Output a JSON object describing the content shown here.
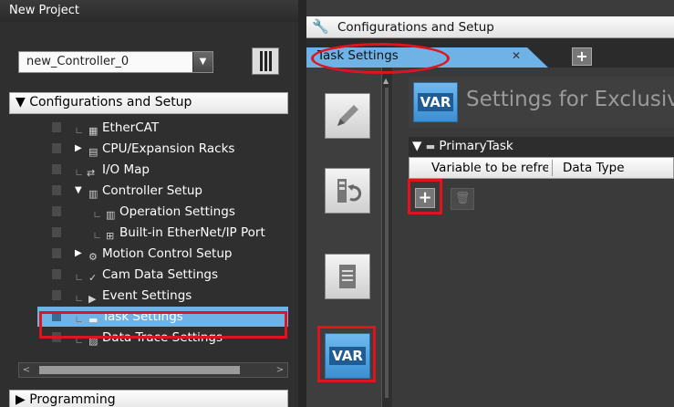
{
  "project": {
    "title": "New Project"
  },
  "controller": {
    "selected": "new_Controller_0"
  },
  "sections": {
    "config": "Configurations and Setup",
    "programming": "Programming"
  },
  "tree": [
    {
      "label": "EtherCAT",
      "icon": "ethercat-icon",
      "arrow": ""
    },
    {
      "label": "CPU/Expansion Racks",
      "icon": "cpu-rack-icon",
      "arrow": "▶"
    },
    {
      "label": "I/O Map",
      "icon": "io-map-icon",
      "arrow": ""
    },
    {
      "label": "Controller Setup",
      "icon": "controller-setup-icon",
      "arrow": "▼"
    },
    {
      "label": "Operation Settings",
      "icon": "operation-settings-icon",
      "arrow": ""
    },
    {
      "label": "Built-in EtherNet/IP Port",
      "icon": "ethernet-port-icon",
      "arrow": ""
    },
    {
      "label": "Motion Control Setup",
      "icon": "gear-icon",
      "arrow": "▶"
    },
    {
      "label": "Cam Data Settings",
      "icon": "cam-icon",
      "arrow": ""
    },
    {
      "label": "Event Settings",
      "icon": "event-icon",
      "arrow": "▶"
    },
    {
      "label": "Task Settings",
      "icon": "folder-icon",
      "arrow": ""
    },
    {
      "label": "Data Trace Settings",
      "icon": "trace-icon",
      "arrow": ""
    }
  ],
  "editor": {
    "window_title": "Configurations and Setup",
    "tab_label": "Task Settings",
    "var_icon_label": "VAR",
    "heading": "Settings for Exclusive",
    "group": "PrimaryTask",
    "columns": [
      "Variable to be refreshed",
      "Data Type"
    ]
  },
  "colors": {
    "accent": "#6fb2e6",
    "highlight": "#e0141e"
  }
}
